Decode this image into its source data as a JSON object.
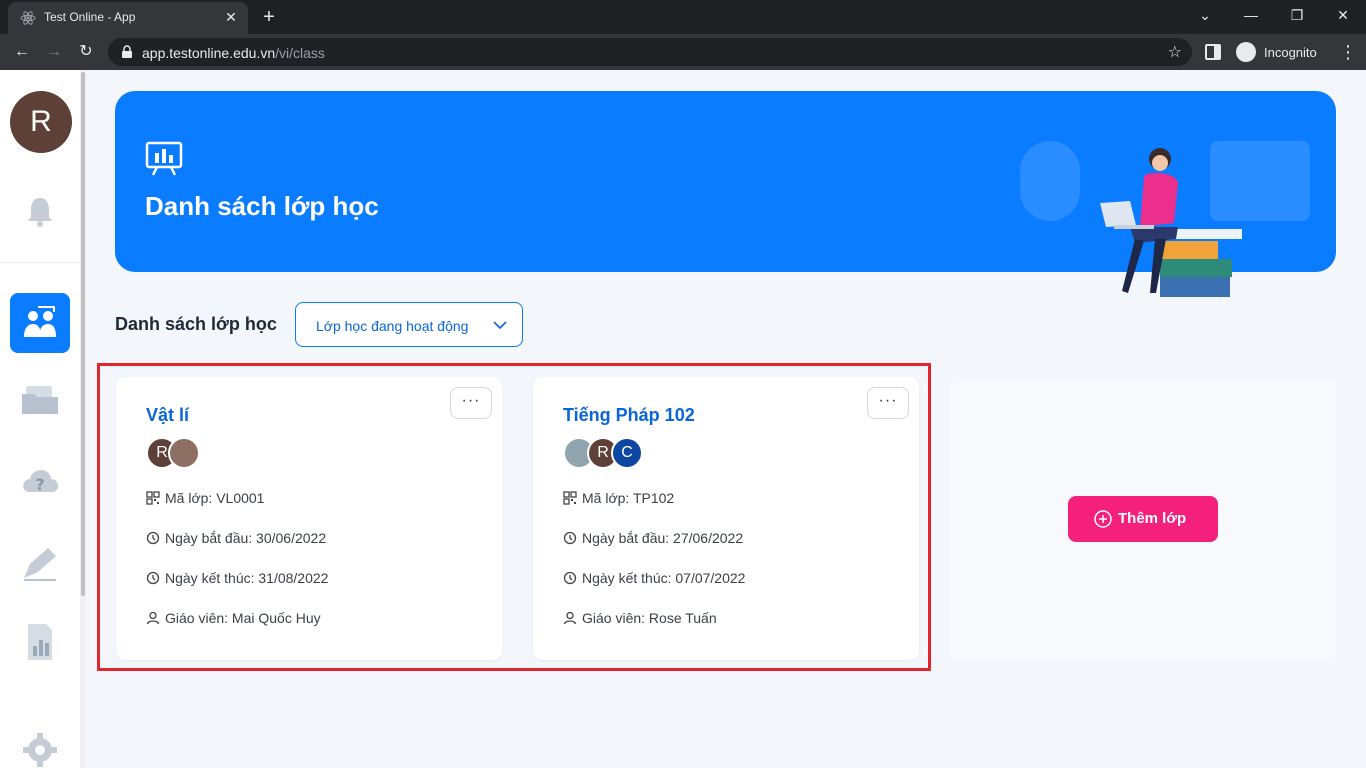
{
  "browser": {
    "tab_title": "Test Online - App",
    "url_host": "app.testonline.edu.vn",
    "url_path": "/vi/class",
    "incognito_label": "Incognito"
  },
  "sidebar": {
    "user_initial": "R",
    "items": [
      {
        "name": "notifications",
        "icon": "bell-icon"
      },
      {
        "name": "classes",
        "icon": "classroom-icon",
        "active": true
      },
      {
        "name": "documents",
        "icon": "folder-icon"
      },
      {
        "name": "question-bank",
        "icon": "cloud-question-icon"
      },
      {
        "name": "exams",
        "icon": "pen-icon"
      },
      {
        "name": "reports",
        "icon": "report-icon"
      },
      {
        "name": "settings",
        "icon": "gear-icon"
      }
    ]
  },
  "banner": {
    "title": "Danh sách lớp học"
  },
  "classes_section": {
    "title": "Danh sách lớp học",
    "filter_value": "Lớp học đang hoạt động"
  },
  "cards": [
    {
      "title": "Vật lí",
      "members": [
        {
          "initial": "R",
          "color": "#5d4037"
        },
        {
          "initial": "",
          "color": "#8d6e63"
        }
      ],
      "code_label": "Mã lớp: VL0001",
      "start_label": "Ngày bắt đầu: 30/06/2022",
      "end_label": "Ngày kết thúc: 31/08/2022",
      "teacher_label": "Giáo viên: Mai Quốc Huy"
    },
    {
      "title": "Tiếng Pháp 102",
      "members": [
        {
          "initial": "",
          "color": "#90a4ae"
        },
        {
          "initial": "R",
          "color": "#5d4037"
        },
        {
          "initial": "C",
          "color": "#0d47a1"
        }
      ],
      "code_label": "Mã lớp: TP102",
      "start_label": "Ngày bắt đầu: 27/06/2022",
      "end_label": "Ngày kết thúc: 07/07/2022",
      "teacher_label": "Giáo viên: Rose Tuấn"
    }
  ],
  "add_class": {
    "label": "Thêm lớp"
  },
  "colors": {
    "primary": "#0a7cff",
    "accent_pink": "#f5207c",
    "highlight_red": "#e3252e"
  }
}
